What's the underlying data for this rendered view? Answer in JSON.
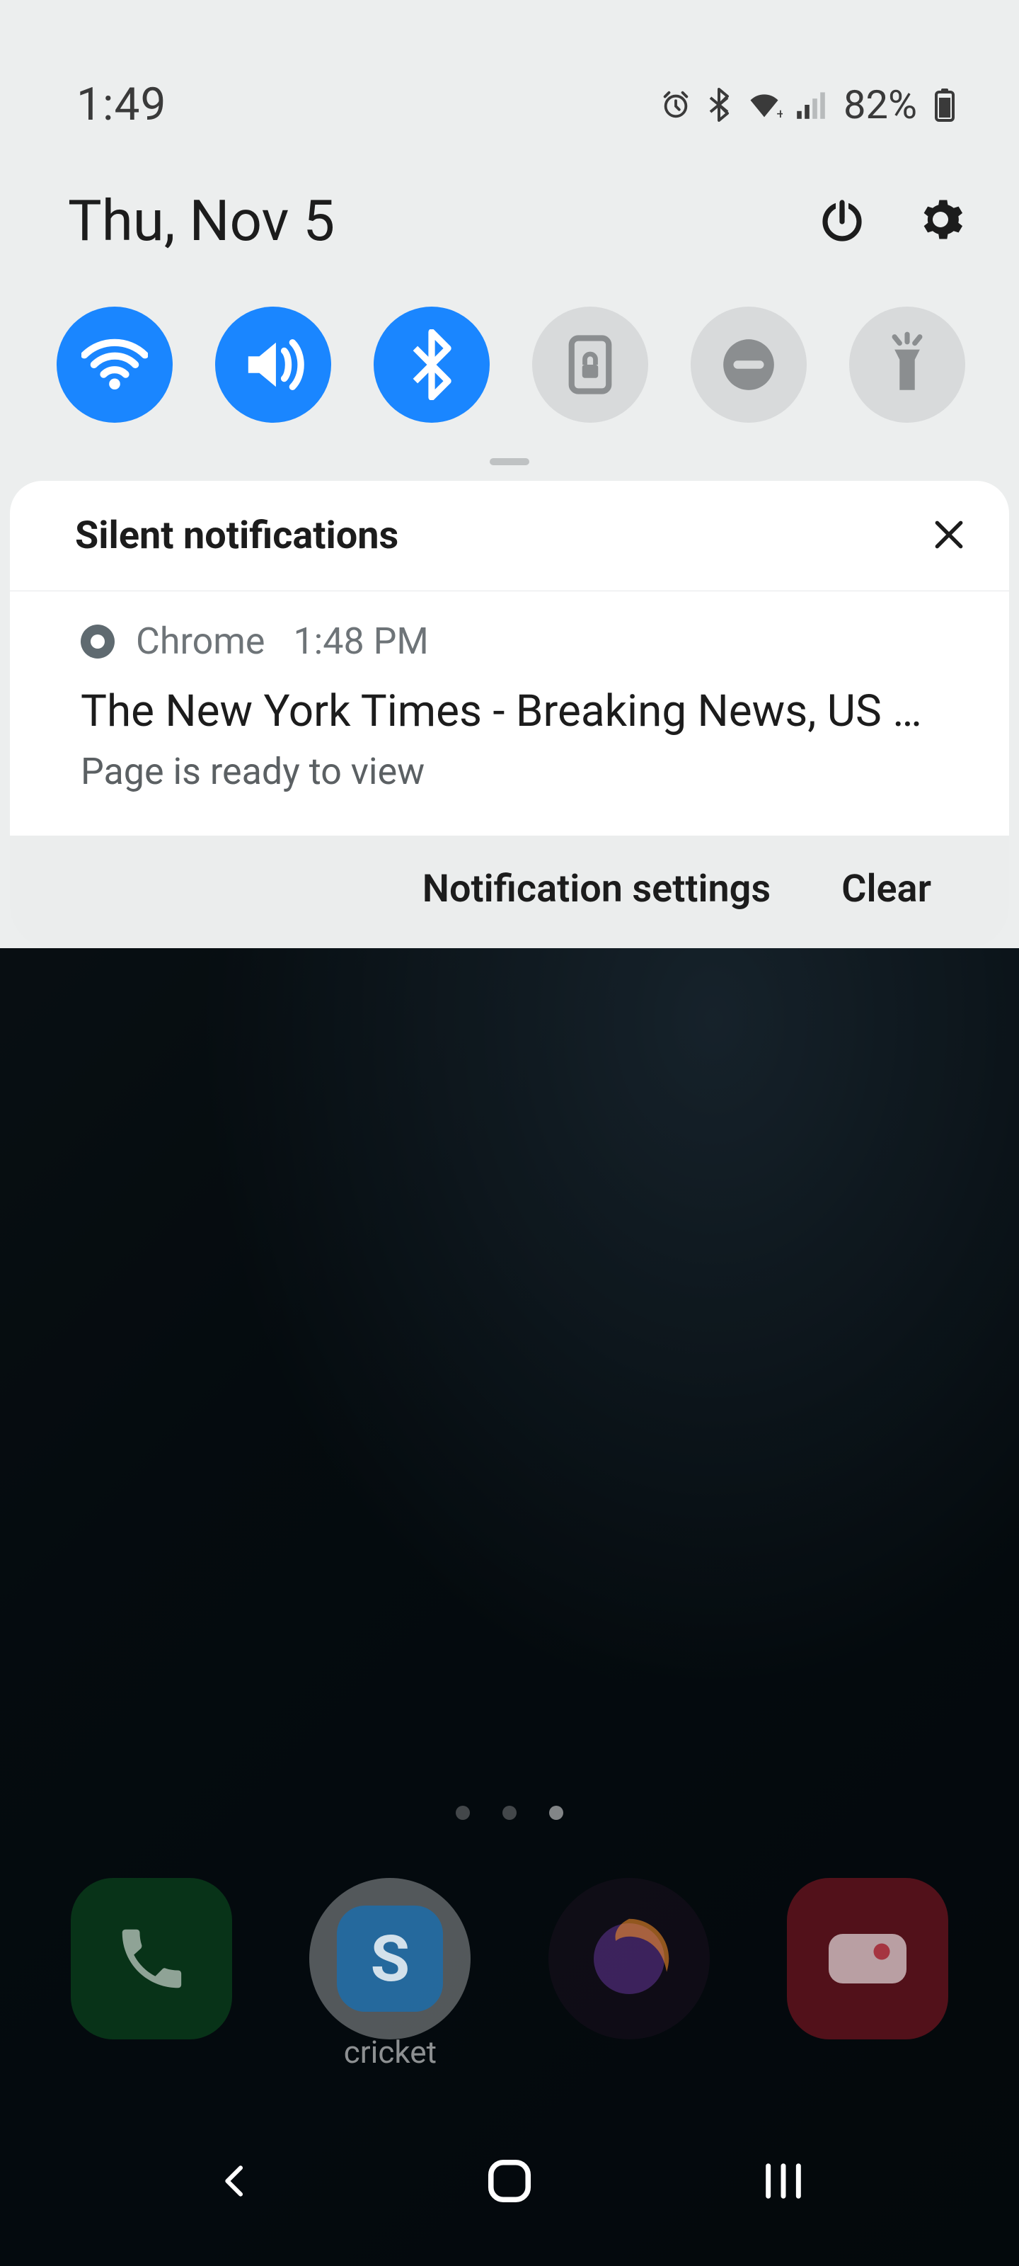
{
  "status": {
    "time": "1:49",
    "battery_text": "82%"
  },
  "date_row": {
    "date": "Thu, Nov 5"
  },
  "quick_settings": {
    "tiles": [
      {
        "name": "wifi",
        "active": true
      },
      {
        "name": "sound",
        "active": true
      },
      {
        "name": "bluetooth",
        "active": true
      },
      {
        "name": "rotation",
        "active": false
      },
      {
        "name": "dnd",
        "active": false
      },
      {
        "name": "flashlight",
        "active": false
      }
    ]
  },
  "silent_header": "Silent notifications",
  "notification": {
    "app": "Chrome",
    "time": "1:48 PM",
    "title": "The New York Times - Breaking News, US Ne..",
    "subtitle": "Page is ready to view"
  },
  "footer": {
    "settings": "Notification settings",
    "clear": "Clear"
  },
  "dock": {
    "apps": [
      {
        "name": "phone",
        "bg": "#0b5b22",
        "label": ""
      },
      {
        "name": "skype",
        "bg": "#e9ebec",
        "label": "cricket"
      },
      {
        "name": "firefox",
        "bg": "#1a1020",
        "label": ""
      },
      {
        "name": "camera",
        "bg": "#7e1a22",
        "label": ""
      }
    ]
  }
}
